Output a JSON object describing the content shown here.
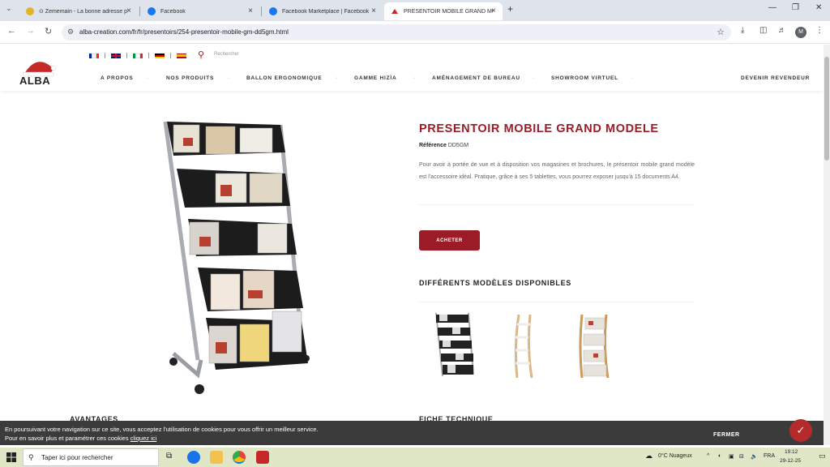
{
  "browser": {
    "tabs": [
      {
        "title": "⊙ Zememain - La bonne adresse p",
        "favicon": "zememain-icon"
      },
      {
        "title": "Facebook",
        "favicon": "facebook-icon"
      },
      {
        "title": "Facebook Marketplace | Facebook",
        "favicon": "facebook-icon"
      },
      {
        "title": "PRESENTOIR MOBILE GRAND MOD",
        "favicon": "alba-icon",
        "active": true
      }
    ],
    "url": "alba-creation.com/fr/fr/presentoirs/254-presentoir-mobile-gm-dd5gm.html",
    "profile_initial": "M"
  },
  "site": {
    "logo_text": "ALBA",
    "search_placeholder": "Rechercher",
    "menu": [
      "A PROPOS",
      "NOS PRODUITS",
      "BALLON ERGONOMIQUE",
      "GAMME HIZÏA",
      "AMÉNAGEMENT DE BUREAU",
      "SHOWROOM VIRTUEL",
      "DEVENIR REVENDEUR"
    ]
  },
  "product": {
    "title": "PRESENTOIR MOBILE GRAND MODELE",
    "ref_label": "Référence",
    "ref_value": "DD5GM",
    "description": "Pour avoir à portée de vue et à disposition vos magasines et brochures, le présentoir mobile grand modèle est l'accessoire idéal. Pratique, grâce à ses 5 tablettes, vous pourrez exposer jusqu'à 15 documents A4.",
    "buy_label": "ACHETER",
    "models_heading": "DIFFÉRENTS MODÈLES DISPONIBLES",
    "advantages_heading": "AVANTAGES",
    "tech_heading": "FICHE TECHNIQUE"
  },
  "cookie": {
    "line1": "En poursuivant votre navigation sur ce site, vous acceptez l'utilisation de cookies pour vous offrir un meilleur service.",
    "line2": "Pour en savoir plus et paramétrer ces cookies",
    "link": "cliquez ici",
    "close": "FERMER"
  },
  "taskbar": {
    "search_placeholder": "Taper ici pour rechercher",
    "weather": "0°C  Nuageux",
    "lang": "FRA",
    "time": "19:12",
    "date": "29-12-25"
  },
  "colors": {
    "brand": "#9b1c26",
    "banner": "#3b3b3b"
  }
}
